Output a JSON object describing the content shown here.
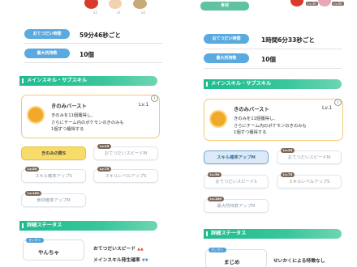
{
  "left": {
    "lv_label": "",
    "counts": [
      "x1",
      "x1",
      "x3"
    ],
    "help_interval": {
      "label": "おてつだい時間",
      "value": "59分46秒ごと"
    },
    "max_carry": {
      "label": "最大所持数",
      "value": "10個"
    },
    "skills_section": "メインスキル・サブスキル",
    "main_skill": {
      "name": "きのみバースト",
      "level": "Lv.1",
      "description": [
        "きのみを11個獲得し、",
        "さらにチーム内のポケモンのきのみも",
        "1個ずつ獲得する"
      ]
    },
    "sub_skills": [
      {
        "lv": "",
        "label": "きのみの数S",
        "style": "gold"
      },
      {
        "lv": "Lv.25",
        "label": "おてつだいスピードM",
        "style": "plain"
      },
      {
        "lv": "Lv.50",
        "label": "スキル確率アップS",
        "style": "plain"
      },
      {
        "lv": "Lv.75",
        "label": "スキルレベルアップS",
        "style": "plain"
      },
      {
        "lv": "Lv.100",
        "label": "食材確率アップM",
        "style": "plain"
      }
    ],
    "detail_section": "詳細ステータス",
    "personality": {
      "tag": "せいかく",
      "value": "やんちゃ"
    },
    "stats": [
      {
        "label": "おてつだいスピード",
        "arrows": "▲▲",
        "arrows_color": "#e05a4a"
      },
      {
        "label": "メインスキル発生確率",
        "arrows": "▼▼",
        "arrows_color": "#4a90d9"
      }
    ]
  },
  "right": {
    "top_label": "食材",
    "lv_labels": [
      "Lv.30",
      "Lv.60"
    ],
    "help_interval": {
      "label": "おてつだい時間",
      "value": "1時間6分33秒ごと"
    },
    "max_carry": {
      "label": "最大所持数",
      "value": "10個"
    },
    "skills_section": "メインスキル・サブスキル",
    "main_skill": {
      "name": "きのみバースト",
      "level": "Lv.1",
      "description": [
        "きのみを11個獲得し、",
        "さらにチーム内のポケモンのきのみも",
        "1個ずつ獲得する"
      ]
    },
    "sub_skills": [
      {
        "lv": "",
        "label": "スキル確率アップM",
        "style": "blue"
      },
      {
        "lv": "Lv.25",
        "label": "おてつだいスピードM",
        "style": "plain"
      },
      {
        "lv": "Lv.50",
        "label": "おてつだいスピードS",
        "style": "plain"
      },
      {
        "lv": "Lv.75",
        "label": "スキルレベルアップS",
        "style": "plain"
      },
      {
        "lv": "Lv.100",
        "label": "最大所持数アップM",
        "style": "plain"
      }
    ],
    "detail_section": "詳細ステータス",
    "personality": {
      "tag": "せいかく",
      "value": "まじめ"
    },
    "personality_note": "せいかくによる特徴なし"
  },
  "colors": {
    "accent_green": "#2fc393",
    "pill_blue": "#5aa9df",
    "gold": "#f7dc6a"
  }
}
